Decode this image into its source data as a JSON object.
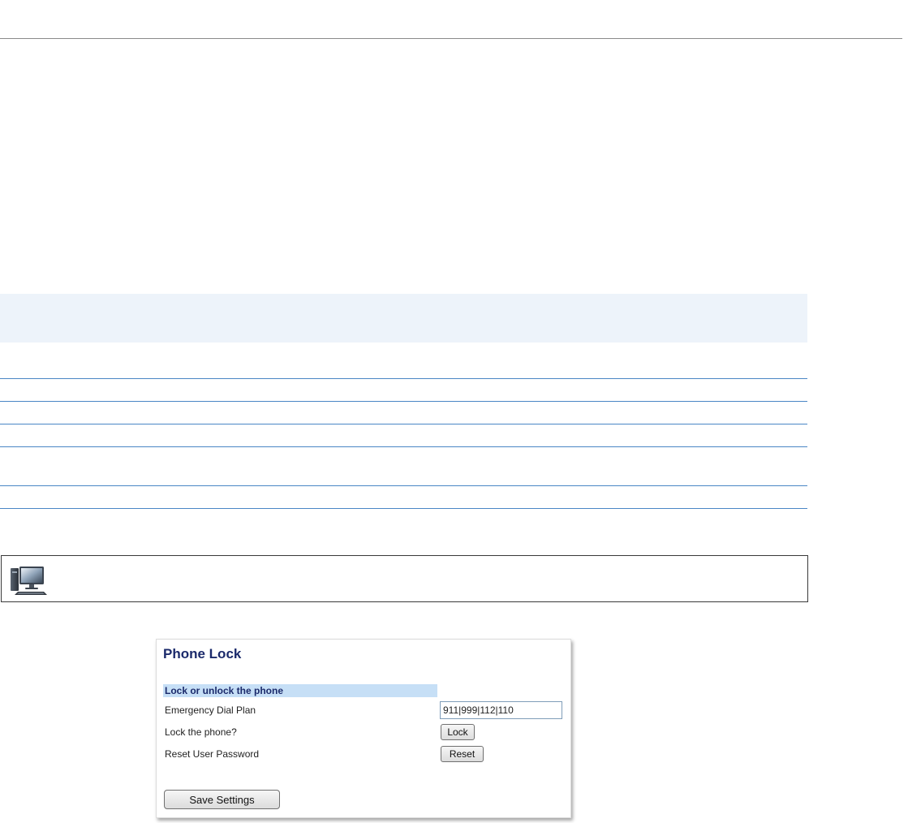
{
  "phone_lock_panel": {
    "title": "Phone Lock",
    "section_header": "Lock or unlock the phone",
    "emergency_dial_plan": {
      "label": "Emergency Dial Plan",
      "value": "911|999|112|110"
    },
    "lock_phone": {
      "label": "Lock the phone?",
      "button_label": "Lock"
    },
    "reset_password": {
      "label": "Reset User Password",
      "button_label": "Reset"
    },
    "save_button_label": "Save Settings"
  },
  "icons": {
    "note_icon": "computer-monitor-icon"
  },
  "colors": {
    "title_text": "#1b2a6b",
    "section_header_bg": "#c6dff6",
    "table_rule": "#4a86c5",
    "table_shade": "#edf3fa"
  }
}
